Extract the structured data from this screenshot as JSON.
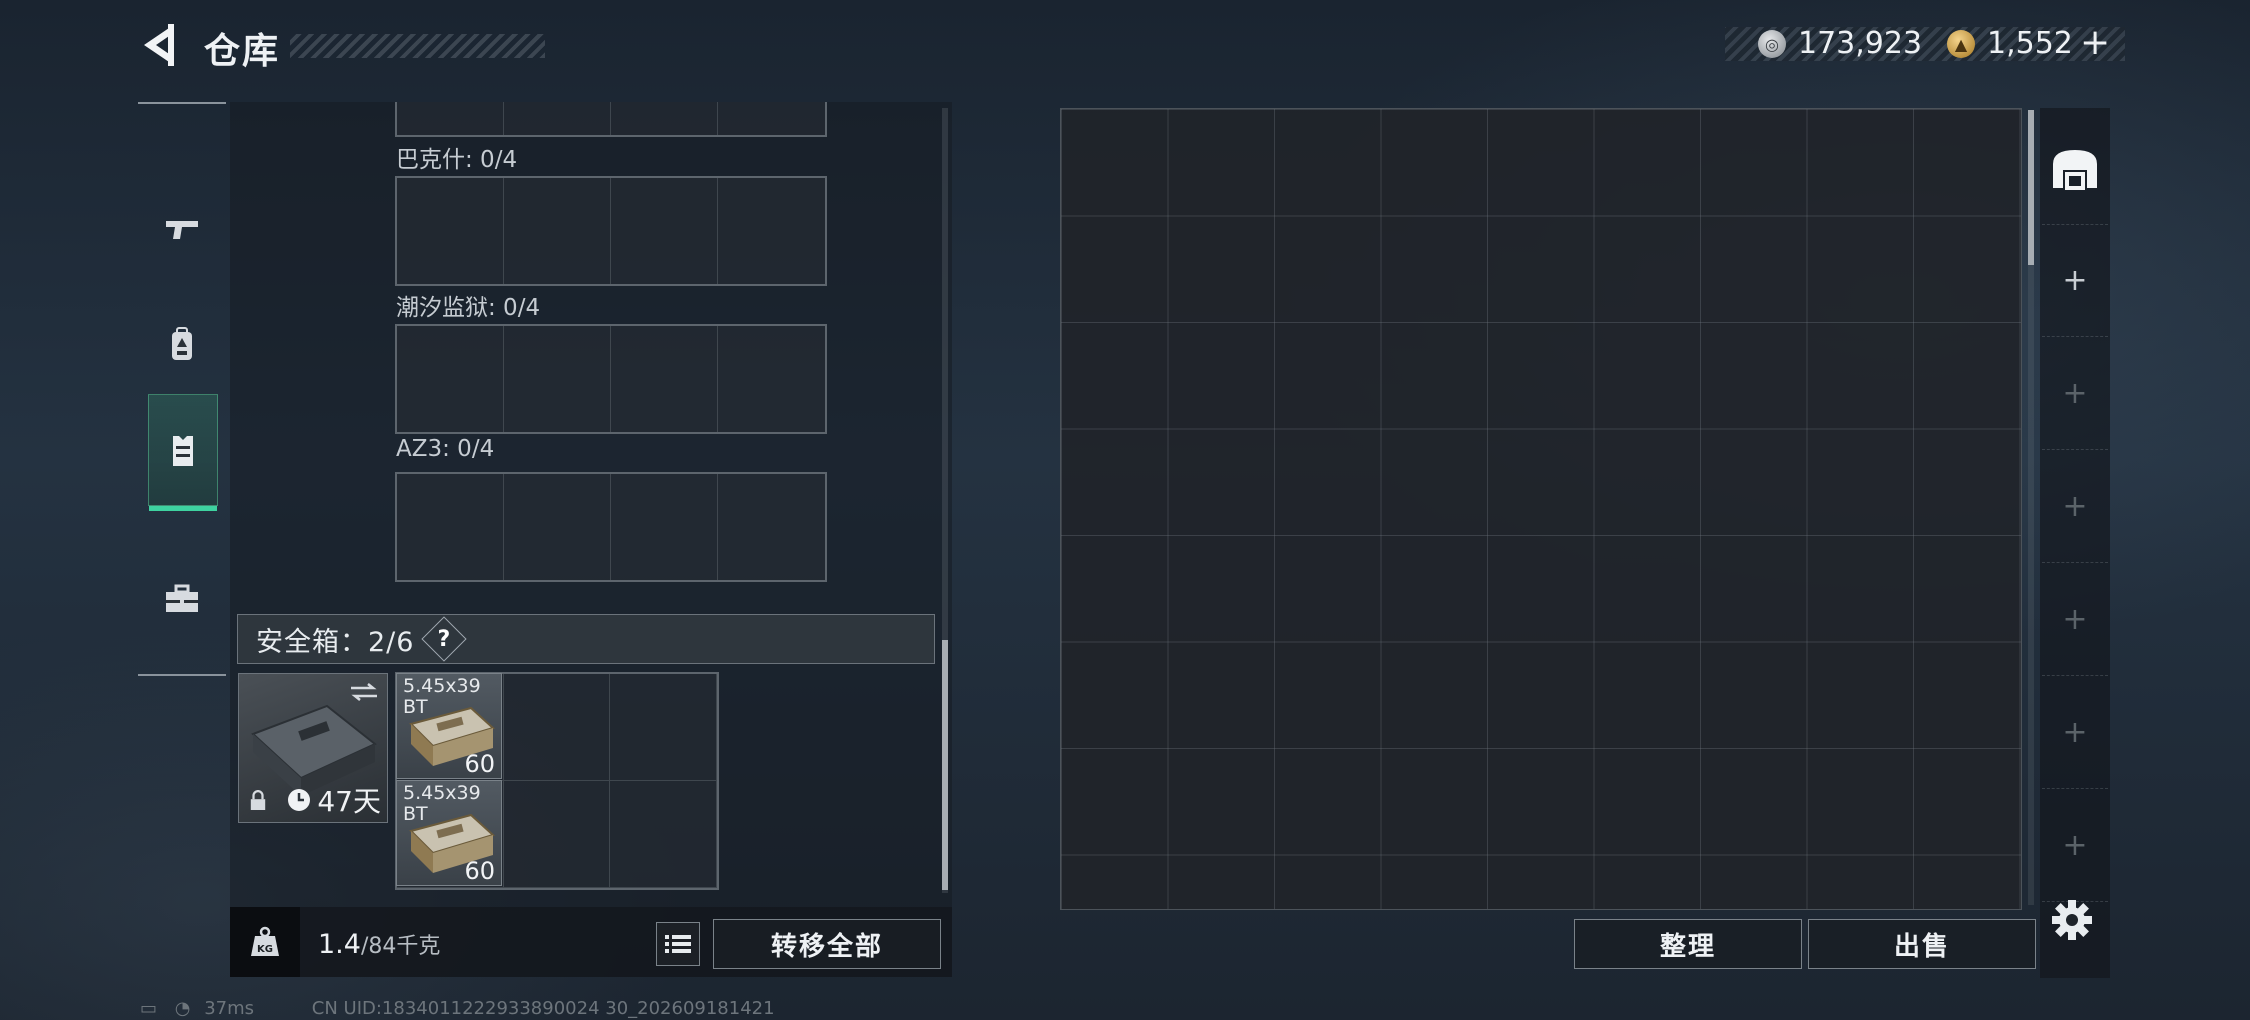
{
  "header": {
    "title": "仓库",
    "currency_silver": "173,923",
    "currency_gold": "1,552",
    "add_symbol": "+"
  },
  "left_tabs": [
    "weapon",
    "backpack",
    "vest",
    "toolbox"
  ],
  "sections": [
    {
      "label": "巴克什: 0/4"
    },
    {
      "label": "潮汐监狱: 0/4"
    },
    {
      "label": "AZ3: 0/4"
    }
  ],
  "safebox": {
    "title": "安全箱：2/6",
    "help": "?",
    "days": "47天",
    "items": [
      {
        "name": "5.45x39 BT",
        "qty": "60"
      },
      {
        "name": "5.45x39 BT",
        "qty": "60"
      }
    ]
  },
  "bottom_left": {
    "weight_value": "1.4",
    "weight_max": "/84千克",
    "weight_icon_label": "KG",
    "transfer_all": "转移全部"
  },
  "bottom_right": {
    "sort": "整理",
    "sell": "出售"
  },
  "right_rail": {
    "plus": "+"
  },
  "status": {
    "ping": "37ms",
    "uid": "CN UID:1834011222933890024 30_202609181421"
  }
}
